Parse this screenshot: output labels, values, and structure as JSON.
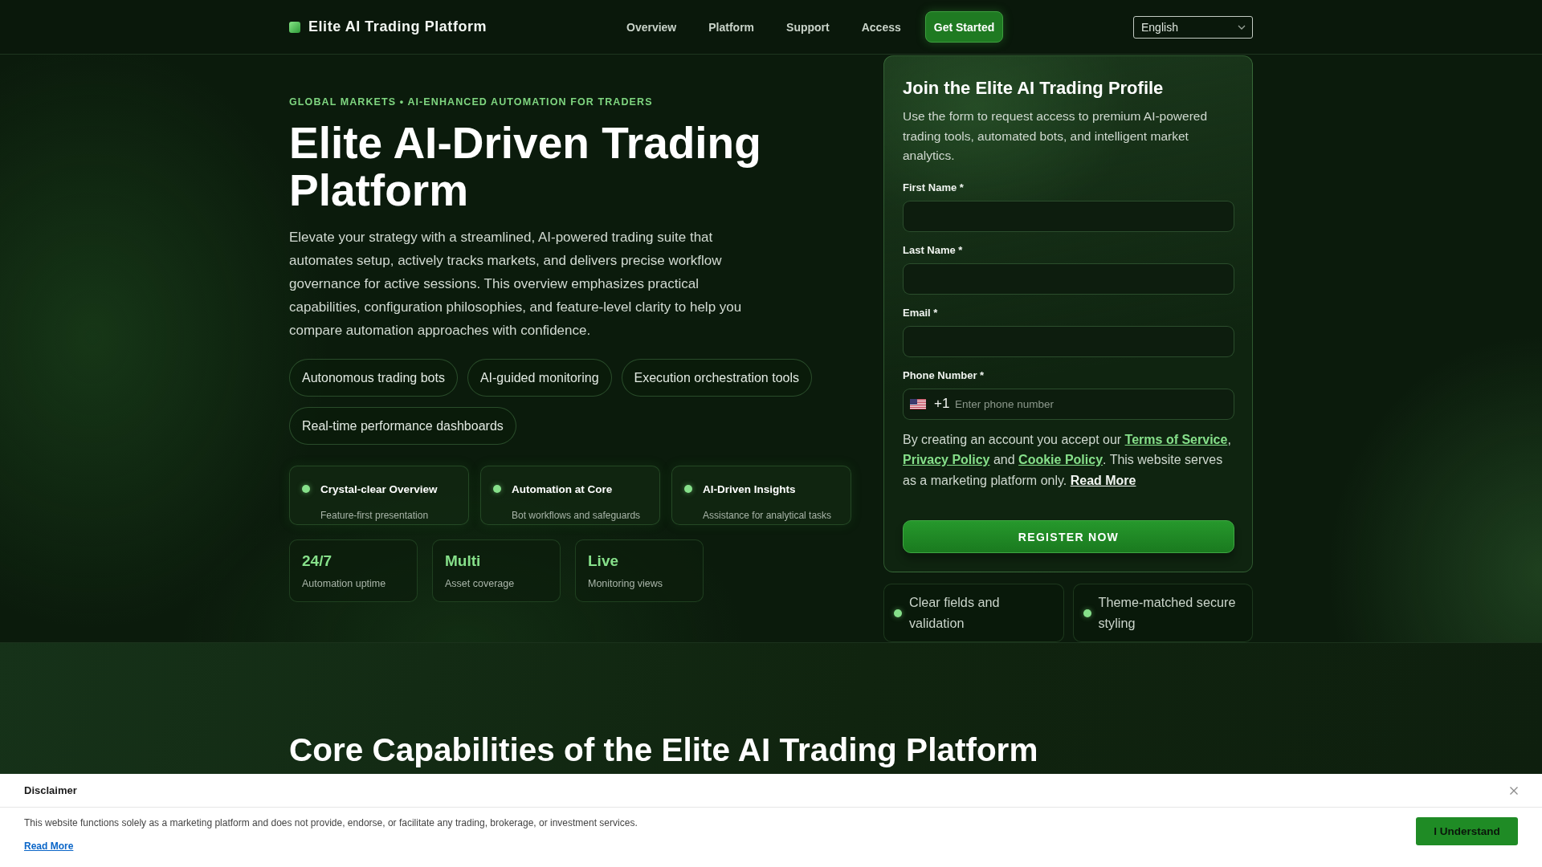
{
  "header": {
    "brand": "Elite AI Trading Platform",
    "nav": [
      {
        "label": "Overview"
      },
      {
        "label": "Platform"
      },
      {
        "label": "Support"
      },
      {
        "label": "Access"
      }
    ],
    "cta": "Get Started",
    "language": "English"
  },
  "hero": {
    "eyebrow": "GLOBAL MARKETS • AI-ENHANCED AUTOMATION FOR TRADERS",
    "title": "Elite AI-Driven Trading Platform",
    "description": "Elevate your strategy with a streamlined, AI-powered trading suite that automates setup, actively tracks markets, and delivers precise workflow governance for active sessions. This overview emphasizes practical capabilities, configuration philosophies, and feature-level clarity to help you compare automation approaches with confidence.",
    "chips": [
      "Autonomous trading bots",
      "AI-guided monitoring",
      "Execution orchestration tools",
      "Real-time performance dashboards"
    ],
    "features": [
      {
        "title": "Crystal-clear Overview",
        "subtitle": "Feature-first presentation"
      },
      {
        "title": "Automation at Core",
        "subtitle": "Bot workflows and safeguards"
      },
      {
        "title": "AI-Driven Insights",
        "subtitle": "Assistance for analytical tasks"
      }
    ],
    "stats": [
      {
        "value": "24/7",
        "label": "Automation uptime"
      },
      {
        "value": "Multi",
        "label": "Asset coverage"
      },
      {
        "value": "Live",
        "label": "Monitoring views"
      }
    ]
  },
  "signup": {
    "title": "Join the Elite AI Trading Profile",
    "description": "Use the form to request access to premium AI-powered trading tools, automated bots, and intelligent market analytics.",
    "fields": [
      {
        "kind": "text",
        "label": "First Name *"
      },
      {
        "kind": "text",
        "label": "Last Name *"
      },
      {
        "kind": "email",
        "label": "Email *"
      },
      {
        "kind": "phone",
        "label": "Phone Number *",
        "code": "+1",
        "placeholder": "Enter phone number"
      }
    ],
    "consent": [
      {
        "kind": "text",
        "text": "By creating an account you accept our "
      },
      {
        "kind": "policy",
        "text": "Terms of Service"
      },
      {
        "kind": "text",
        "text": ", "
      },
      {
        "kind": "policy",
        "text": "Privacy Policy"
      },
      {
        "kind": "text",
        "text": " and "
      },
      {
        "kind": "policy",
        "text": "Cookie Policy"
      },
      {
        "kind": "text",
        "text": ". This website serves as a marketing platform only. "
      },
      {
        "kind": "more",
        "text": "Read More"
      }
    ],
    "button": "REGISTER NOW",
    "notes": [
      "Clear fields and validation",
      "Theme-matched secure styling"
    ]
  },
  "capabilities": {
    "title": "Core Capabilities of the Elite AI Trading Platform"
  },
  "disclaimer": {
    "title": "Disclaimer",
    "text": "This website functions solely as a marketing platform and does not provide, endorse, or facilitate any trading, brokerage, or investment services.",
    "link": "Read More",
    "button": "I Understand"
  }
}
